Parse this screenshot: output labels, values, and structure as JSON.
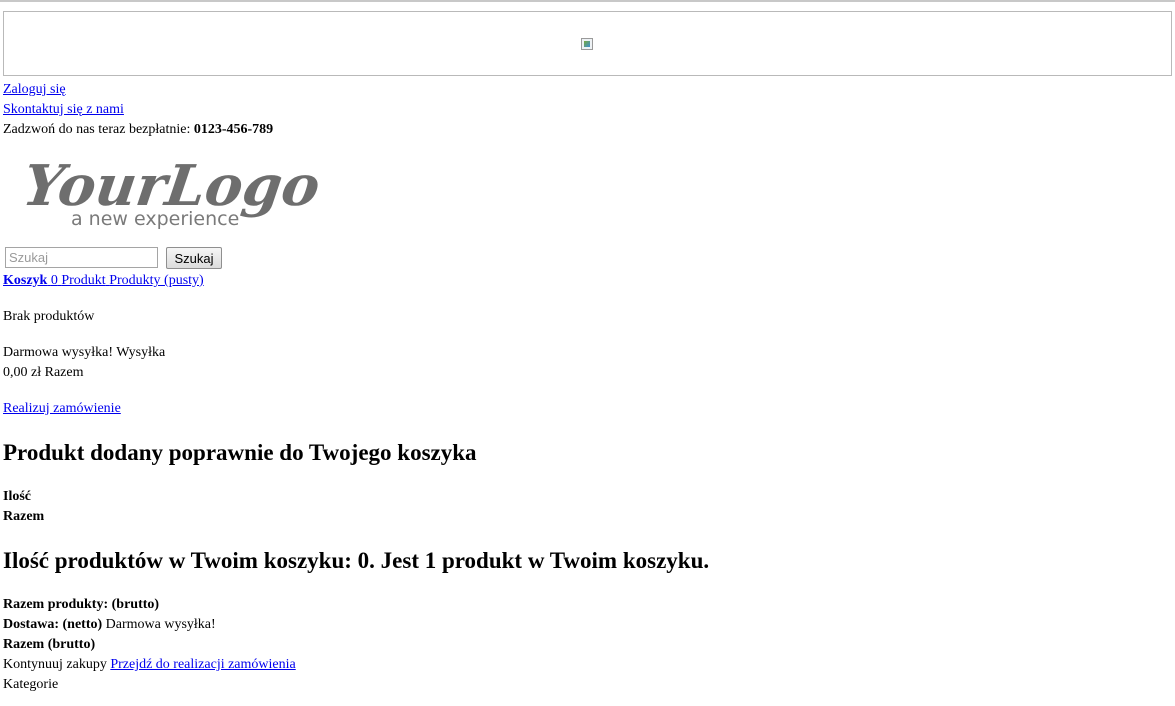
{
  "header": {
    "login_link": "Zaloguj się",
    "contact_link": "Skontaktuj się z nami",
    "call_text": "Zadzwoń do nas teraz bezpłatnie:",
    "phone": "0123-456-789"
  },
  "logo": {
    "main": "YourLogo",
    "tagline": "a new experience"
  },
  "search": {
    "placeholder": "Szukaj",
    "button_label": "Szukaj"
  },
  "cart": {
    "title": "Koszyk",
    "count": "0",
    "unit_singular": "Produkt",
    "unit_plural": "Produkty",
    "empty_label": "(pusty)",
    "no_products": "Brak produktów",
    "free_shipping": "Darmowa wysyłka!",
    "shipping_label": "Wysyłka",
    "total_value": "0,00 zł",
    "total_label": "Razem",
    "checkout_link": "Realizuj zamówienie"
  },
  "layer_cart": {
    "success_heading": "Produkt dodany poprawnie do Twojego koszyka",
    "quantity_label": "Ilość",
    "total_label": "Razem",
    "summary_heading": "Ilość produktów w Twoim koszyku: 0. Jest 1 produkt w Twoim koszyku.",
    "products_total_label": "Razem produkty: (brutto)",
    "shipping_label": "Dostawa: (netto)",
    "shipping_value": "Darmowa wysyłka!",
    "grand_total_label": "Razem (brutto)",
    "continue_label": "Kontynuuj zakupy",
    "proceed_link": "Przejdź do realizacji zamówienia"
  },
  "categories_label": "Kategorie",
  "colors": {
    "link": "#0000ee",
    "logo_gray": "#6e6e6e"
  }
}
